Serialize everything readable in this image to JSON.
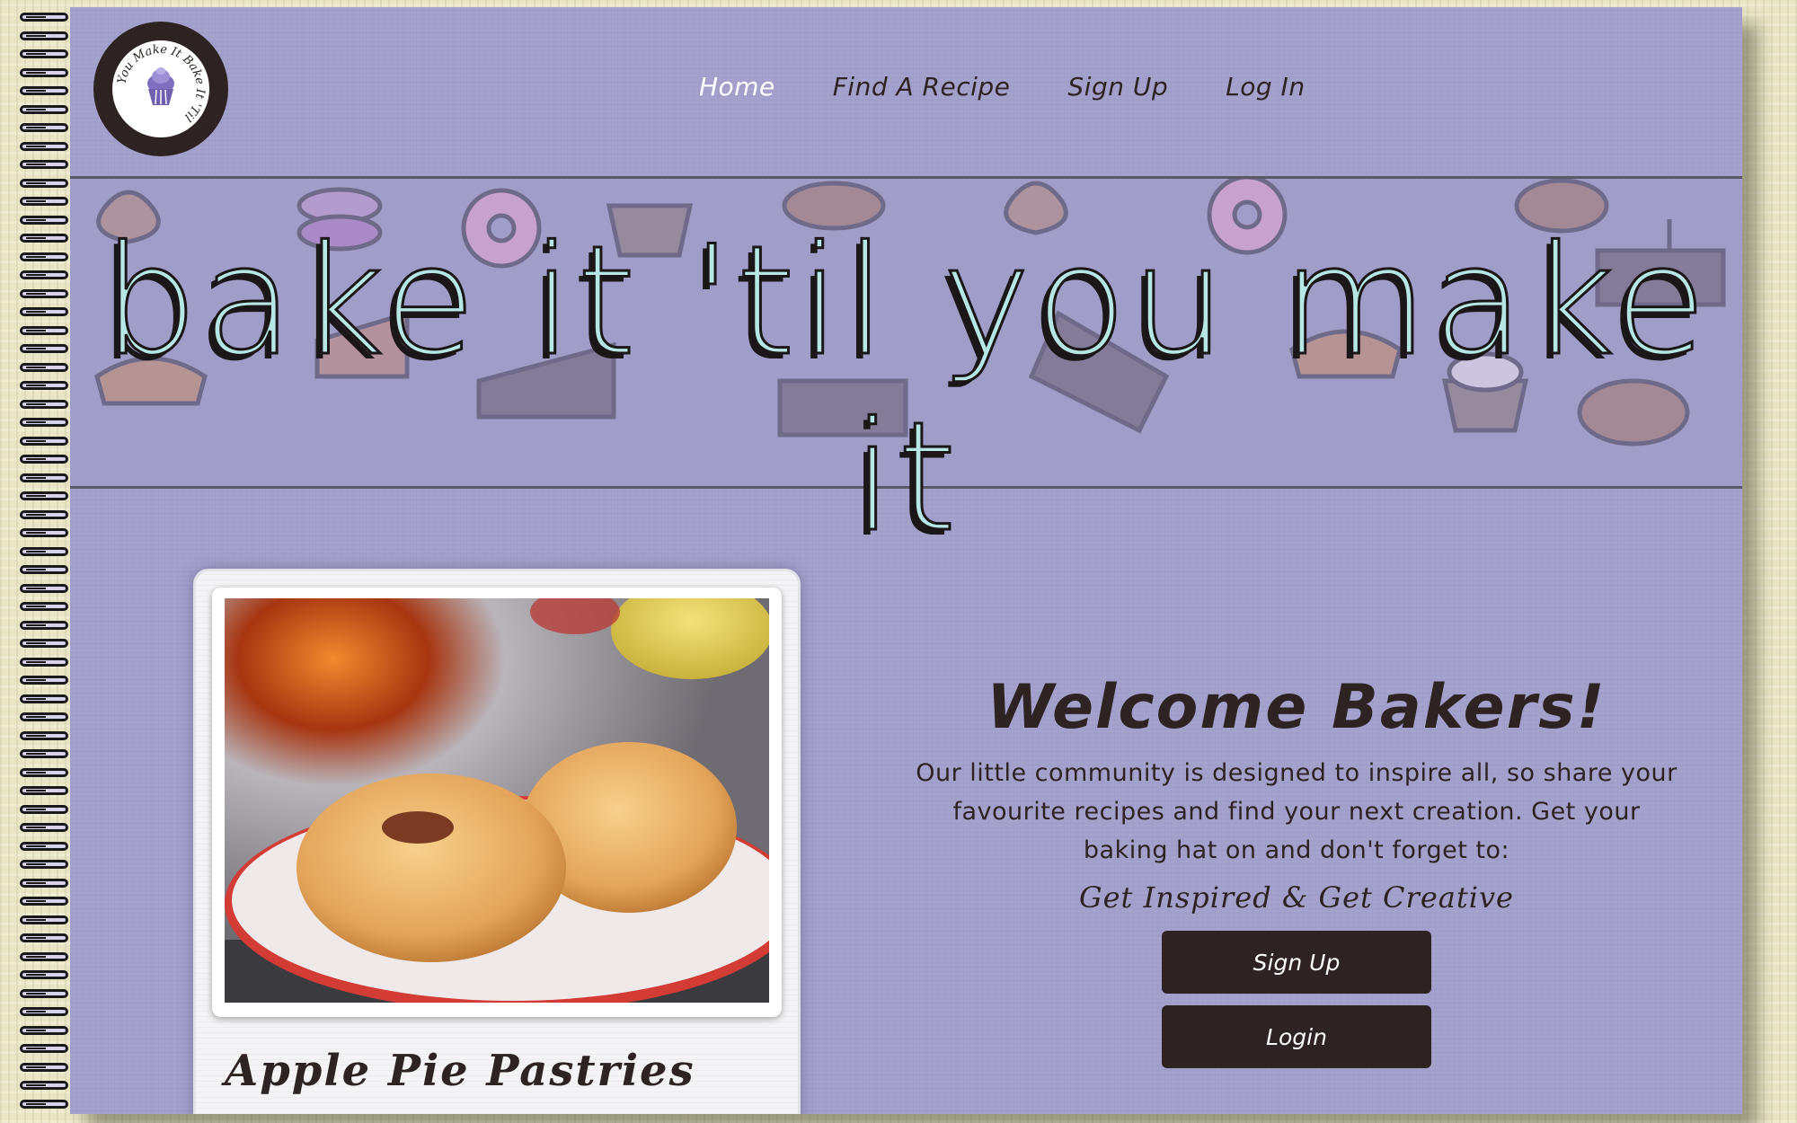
{
  "site": {
    "logo_text": "You Make It Bake It 'Til",
    "banner_title": "bake it 'til you make it"
  },
  "nav": {
    "items": [
      {
        "label": "Home",
        "active": true
      },
      {
        "label": "Find A Recipe",
        "active": false
      },
      {
        "label": "Sign Up",
        "active": false
      },
      {
        "label": "Log In",
        "active": false
      }
    ]
  },
  "featured": {
    "title": "Apple Pie Pastries",
    "image": "apple pie pastries on plate"
  },
  "welcome": {
    "title": "Welcome Bakers!",
    "text": "Our little community is designed to inspire all, so share your favourite recipes and find your next creation. Get your baking hat on and don't forget to:",
    "tagline": "Get Inspired & Get Creative",
    "signup_label": "Sign Up",
    "login_label": "Login"
  },
  "colors": {
    "page": "#a29fcb",
    "title_fill": "#b7e7e4",
    "dark": "#2c2322",
    "active_nav": "#ffffff"
  }
}
